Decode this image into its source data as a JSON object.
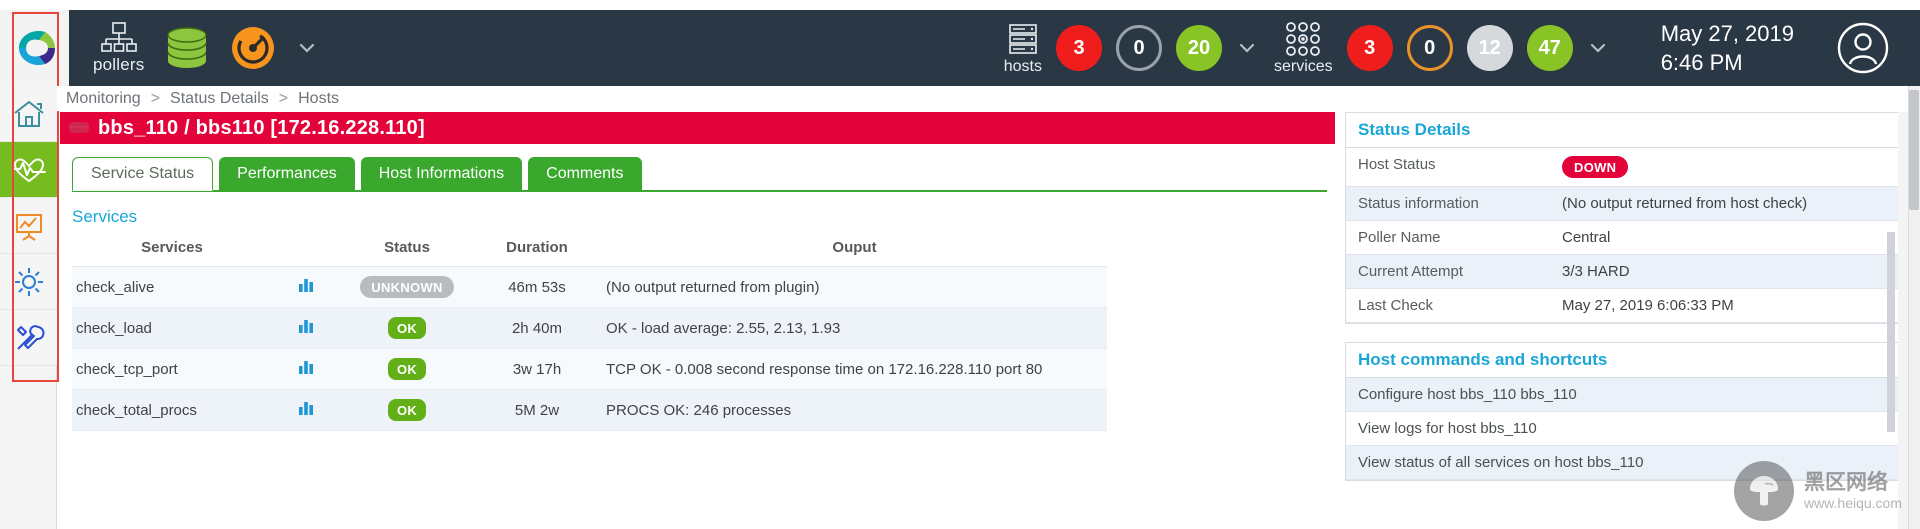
{
  "topbar": {
    "logo_name": "centreon-logo",
    "pollers_label": "pollers",
    "hosts_label": "hosts",
    "services_label": "services",
    "hosts_badges": [
      {
        "value": "3",
        "style": "red",
        "name": "hosts-down-badge"
      },
      {
        "value": "0",
        "style": "hollow-grey",
        "name": "hosts-unreachable-badge"
      },
      {
        "value": "20",
        "style": "green",
        "name": "hosts-up-badge"
      }
    ],
    "services_badges": [
      {
        "value": "3",
        "style": "red",
        "name": "services-critical-badge"
      },
      {
        "value": "0",
        "style": "hollow-orange",
        "name": "services-warning-badge"
      },
      {
        "value": "12",
        "style": "grey-solid",
        "name": "services-unknown-badge"
      },
      {
        "value": "47",
        "style": "green",
        "name": "services-ok-badge"
      }
    ],
    "date": "May 27, 2019",
    "time": "6:46 PM",
    "colors": {
      "bar": "#2a3744",
      "red": "#f01d1d",
      "green": "#88c425",
      "orange": "#e8922a",
      "grey": "#d6d9dc"
    }
  },
  "sidebar": {
    "items": [
      {
        "name": "sidebar-item-home",
        "icon": "home-icon",
        "active": false
      },
      {
        "name": "sidebar-item-monitoring",
        "icon": "heartbeat-icon",
        "active": true
      },
      {
        "name": "sidebar-item-reporting",
        "icon": "chart-board-icon",
        "active": false
      },
      {
        "name": "sidebar-item-configuration",
        "icon": "gear-icon",
        "active": false
      },
      {
        "name": "sidebar-item-administration",
        "icon": "tools-icon",
        "active": false
      }
    ]
  },
  "breadcrumb": {
    "items": [
      "Monitoring",
      "Status Details",
      "Hosts"
    ],
    "separator": ">"
  },
  "host": {
    "title": "bbs_110 / bbs110 [172.16.228.110]",
    "title_bar_color": "#e4023b"
  },
  "tabs": [
    {
      "label": "Service Status",
      "active": true,
      "name": "tab-service-status"
    },
    {
      "label": "Performances",
      "active": false,
      "name": "tab-performances"
    },
    {
      "label": "Host Informations",
      "active": false,
      "name": "tab-host-informations"
    },
    {
      "label": "Comments",
      "active": false,
      "name": "tab-comments"
    }
  ],
  "services_section": {
    "heading": "Services",
    "columns": [
      "Services",
      "",
      "Status",
      "Duration",
      "Ouput"
    ],
    "rows": [
      {
        "name": "check_alive",
        "graph_icon": "bar-chart-icon",
        "status": "UNKNOWN",
        "status_style": "unknown",
        "duration": "46m 53s",
        "output": "(No output returned from plugin)"
      },
      {
        "name": "check_load",
        "graph_icon": "bar-chart-icon",
        "status": "OK",
        "status_style": "ok",
        "duration": "2h 40m",
        "output": "OK - load average: 2.55, 2.13, 1.93"
      },
      {
        "name": "check_tcp_port",
        "graph_icon": "bar-chart-icon",
        "status": "OK",
        "status_style": "ok",
        "duration": "3w 17h",
        "output": "TCP OK - 0.008 second response time on 172.16.228.110 port 80"
      },
      {
        "name": "check_total_procs",
        "graph_icon": "bar-chart-icon",
        "status": "OK",
        "status_style": "ok",
        "duration": "5M 2w",
        "output": "PROCS OK: 246 processes"
      }
    ]
  },
  "status_details": {
    "heading": "Status Details",
    "rows": [
      {
        "key": "Host Status",
        "value": "DOWN",
        "is_badge": true,
        "badge_color": "#e4023b"
      },
      {
        "key": "Status information",
        "value": "(No output returned from host check)",
        "is_badge": false
      },
      {
        "key": "Poller Name",
        "value": "Central",
        "is_badge": false
      },
      {
        "key": "Current Attempt",
        "value": "3/3 HARD",
        "is_badge": false
      },
      {
        "key": "Last Check",
        "value": "May 27, 2019 6:06:33 PM",
        "is_badge": false
      }
    ]
  },
  "host_commands": {
    "heading": "Host commands and shortcuts",
    "items": [
      "Configure host bbs_110 bbs_110",
      "View logs for host bbs_110",
      "View status of all services on host bbs_110"
    ]
  },
  "watermark": {
    "cn": "黑区网络",
    "url": "www.heiqu.com"
  }
}
